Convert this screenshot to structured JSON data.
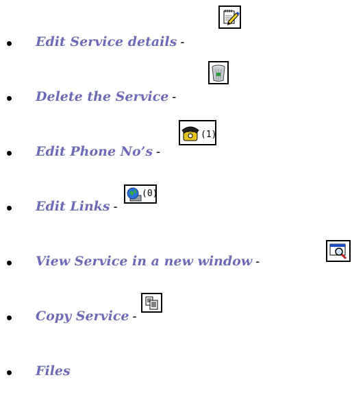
{
  "items": [
    {
      "label": "Edit Service details",
      "separator": "-",
      "icon": "edit-notepad-icon"
    },
    {
      "label": "Delete the Service",
      "separator": "-",
      "icon": "trash-can-icon"
    },
    {
      "label": "Edit Phone No’s",
      "separator": "-",
      "icon": "telephone-icon",
      "count": "(1)"
    },
    {
      "label": "Edit Links",
      "separator": "-",
      "icon": "globe-computer-icon",
      "count": "(0)"
    },
    {
      "label": "View Service  in a new window",
      "separator": "-",
      "icon": "magnifier-window-icon"
    },
    {
      "label": "Copy Service",
      "separator": "-",
      "icon": "copy-pages-icon"
    },
    {
      "label": "Files"
    }
  ],
  "colors": {
    "link": "#6b6bb8",
    "bullet": "#000000"
  }
}
